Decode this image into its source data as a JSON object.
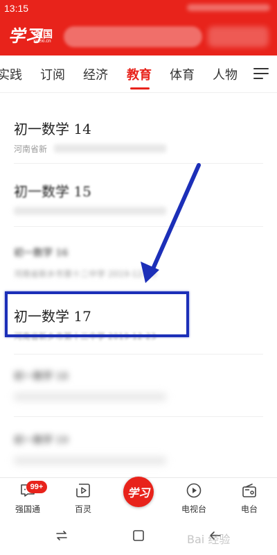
{
  "status_bar": {
    "time": "13:15"
  },
  "header": {
    "logo_script": "学习",
    "logo_text": "强国",
    "logo_sub": "xuexi.cn"
  },
  "tabs": {
    "items": [
      {
        "label": "实践"
      },
      {
        "label": "订阅"
      },
      {
        "label": "经济"
      },
      {
        "label": "教育",
        "active": true
      },
      {
        "label": "体育"
      },
      {
        "label": "人物"
      }
    ]
  },
  "list": {
    "items": [
      {
        "title": "初一数学 14",
        "meta": "河南省新"
      },
      {
        "title": "初一数学 15",
        "meta": ""
      },
      {
        "title": "初一数学 16",
        "meta": "河南省新乡市第十二中学 2019-12-23"
      },
      {
        "title": "初一数学 17",
        "meta": "河南省新乡市第十二中学 2019-12-23"
      },
      {
        "title": "初一数学 18",
        "meta": ""
      },
      {
        "title": "初一数学 19",
        "meta": ""
      }
    ]
  },
  "bottom_nav": {
    "badge": "99+",
    "items": [
      {
        "label": "强国通",
        "icon": "chat-bubble-icon"
      },
      {
        "label": "百灵",
        "icon": "play-square-icon"
      },
      {
        "label": "学习",
        "icon": "xuexi-logo-icon"
      },
      {
        "label": "电视台",
        "icon": "play-circle-icon"
      },
      {
        "label": "电台",
        "icon": "radio-icon"
      }
    ]
  },
  "watermark": "Bai 经验",
  "colors": {
    "brand_red": "#e8231b",
    "highlight_blue": "#1c2fb8",
    "arrow_blue": "#1c2fb8"
  }
}
